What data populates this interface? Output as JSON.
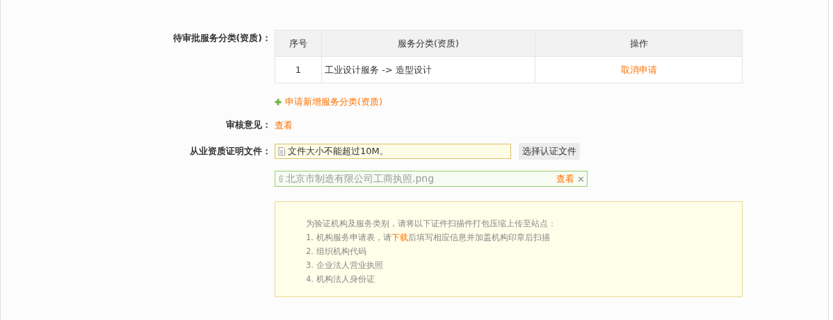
{
  "pending": {
    "label": "待审批服务分类(资质)：",
    "table": {
      "columns": [
        "序号",
        "服务分类(资质)",
        "操作"
      ],
      "rows": [
        {
          "index": "1",
          "category": "工业设计服务 -> 造型设计",
          "action": "取消申请"
        }
      ]
    },
    "add_link": "申请新增服务分类(资质)"
  },
  "review": {
    "label": "审核意见：",
    "link": "查看"
  },
  "certificate": {
    "label": "从业资质证明文件：",
    "placeholder": "文件大小不能超过10M。",
    "button": "选择认证文件",
    "files": [
      {
        "name": "北京市制造有限公司工商执照.png",
        "view": "查看",
        "remove": "×"
      }
    ]
  },
  "notice": {
    "intro": "为验证机构及服务类别，请将以下证件扫描件打包压缩上传至站点：",
    "items": [
      {
        "before": "1. 机构服务申请表，请",
        "link": "下载",
        "after": "后填写相应信息并加盖机构印章后扫描"
      },
      {
        "before": "2. 组织机构代码"
      },
      {
        "before": "3. 企业法人营业执照"
      },
      {
        "before": "4. 机构法人身份证"
      }
    ]
  }
}
